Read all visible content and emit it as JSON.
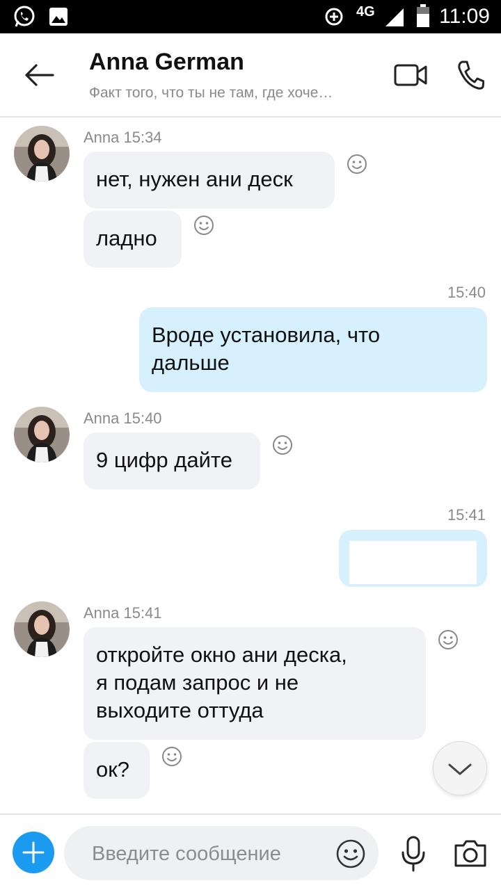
{
  "status_bar": {
    "network": "4G",
    "time": "11:09",
    "icons": [
      "whatsapp-icon",
      "gallery-icon",
      "data-saver-icon",
      "signal-icon",
      "battery-icon"
    ]
  },
  "header": {
    "contact_name": "Anna German",
    "status_message": "Факт того, что ты не там, где хоче…",
    "icons": [
      "back-arrow-icon",
      "video-call-icon",
      "phone-icon"
    ]
  },
  "messages": [
    {
      "sender": "Anna",
      "time": "15:34",
      "meta": "Anna 15:34",
      "text": "нет, нужен ани деск",
      "direction": "in"
    },
    {
      "sender": "Anna",
      "text": "ладно",
      "direction": "in"
    },
    {
      "time": "15:40",
      "text": " Вроде установила, что\nдальше",
      "direction": "out"
    },
    {
      "sender": "Anna",
      "time": "15:40",
      "meta": "Anna 15:40",
      "text": "9 цифр дайте",
      "direction": "in"
    },
    {
      "time": "15:41",
      "text": "",
      "direction": "out"
    },
    {
      "sender": "Anna",
      "time": "15:41",
      "meta": "Anna 15:41",
      "text": "откройте окно ани деска,\nя подам запрос и не\nвыходите оттуда",
      "direction": "in"
    },
    {
      "sender": "Anna",
      "text": "ок?",
      "direction": "in"
    }
  ],
  "composer": {
    "placeholder": "Введите сообщение",
    "icons": [
      "add-icon",
      "emoji-icon",
      "microphone-icon",
      "camera-icon"
    ]
  },
  "colors": {
    "accent": "#1a9bf0",
    "incoming_bubble": "#f0f2f5",
    "outgoing_bubble": "#d6f1fd",
    "meta_text": "#8a8a8a"
  }
}
